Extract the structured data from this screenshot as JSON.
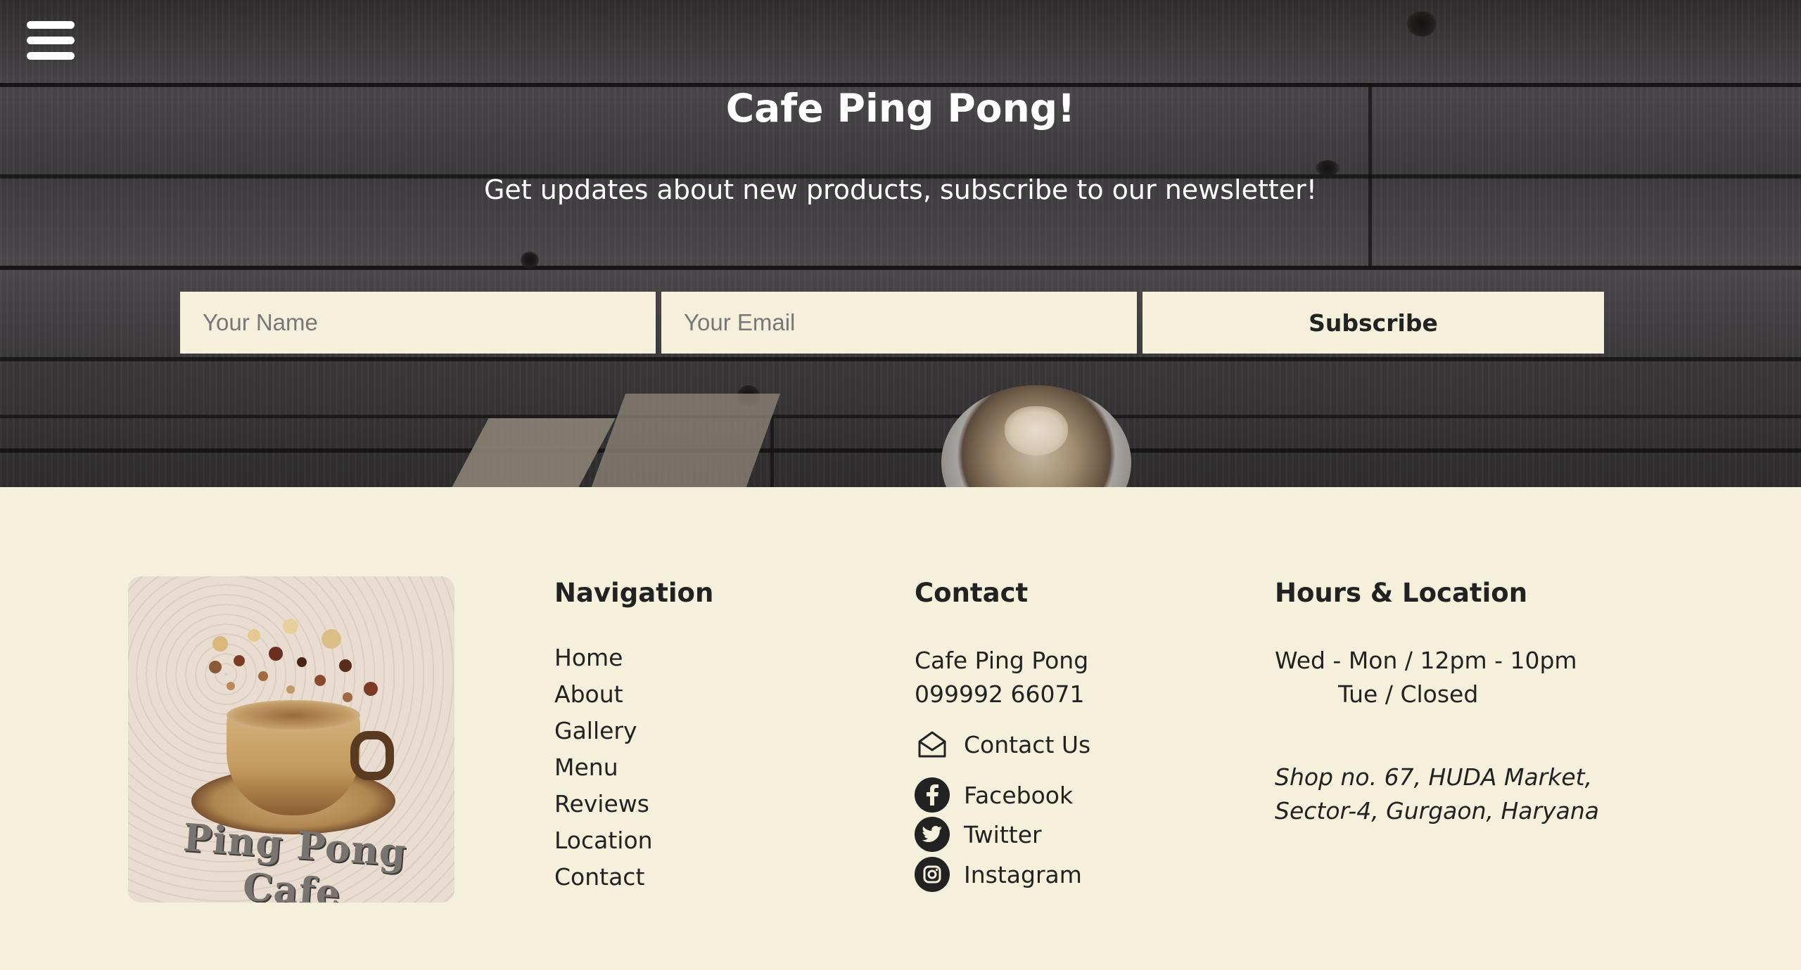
{
  "hero": {
    "title": "Cafe Ping Pong!",
    "subtitle": "Get updates about new products, subscribe to our newsletter!",
    "name_placeholder": "Your Name",
    "email_placeholder": "Your Email",
    "subscribe_label": "Subscribe"
  },
  "logo": {
    "text": "Ping Pong Cafe"
  },
  "navigation": {
    "title": "Navigation",
    "items": [
      "Home",
      "About",
      "Gallery",
      "Menu",
      "Reviews",
      "Location",
      "Contact"
    ]
  },
  "contact": {
    "title": "Contact",
    "name": "Cafe Ping Pong",
    "phone": "099992 66071",
    "contact_us": "Contact Us",
    "facebook": "Facebook",
    "twitter": "Twitter",
    "instagram": "Instagram"
  },
  "hours": {
    "title": "Hours & Location",
    "line1": "Wed - Mon / 12pm - 10pm",
    "line2": "Tue / Closed",
    "address1": "Shop no. 67, HUDA Market,",
    "address2": "Sector-4, Gurgaon, Haryana"
  },
  "colors": {
    "background": "#f4f0dc",
    "text": "#222222",
    "hero_text": "#ffffff"
  },
  "icons": [
    "hamburger-menu-icon",
    "mail-icon",
    "facebook-icon",
    "twitter-icon",
    "instagram-icon"
  ]
}
